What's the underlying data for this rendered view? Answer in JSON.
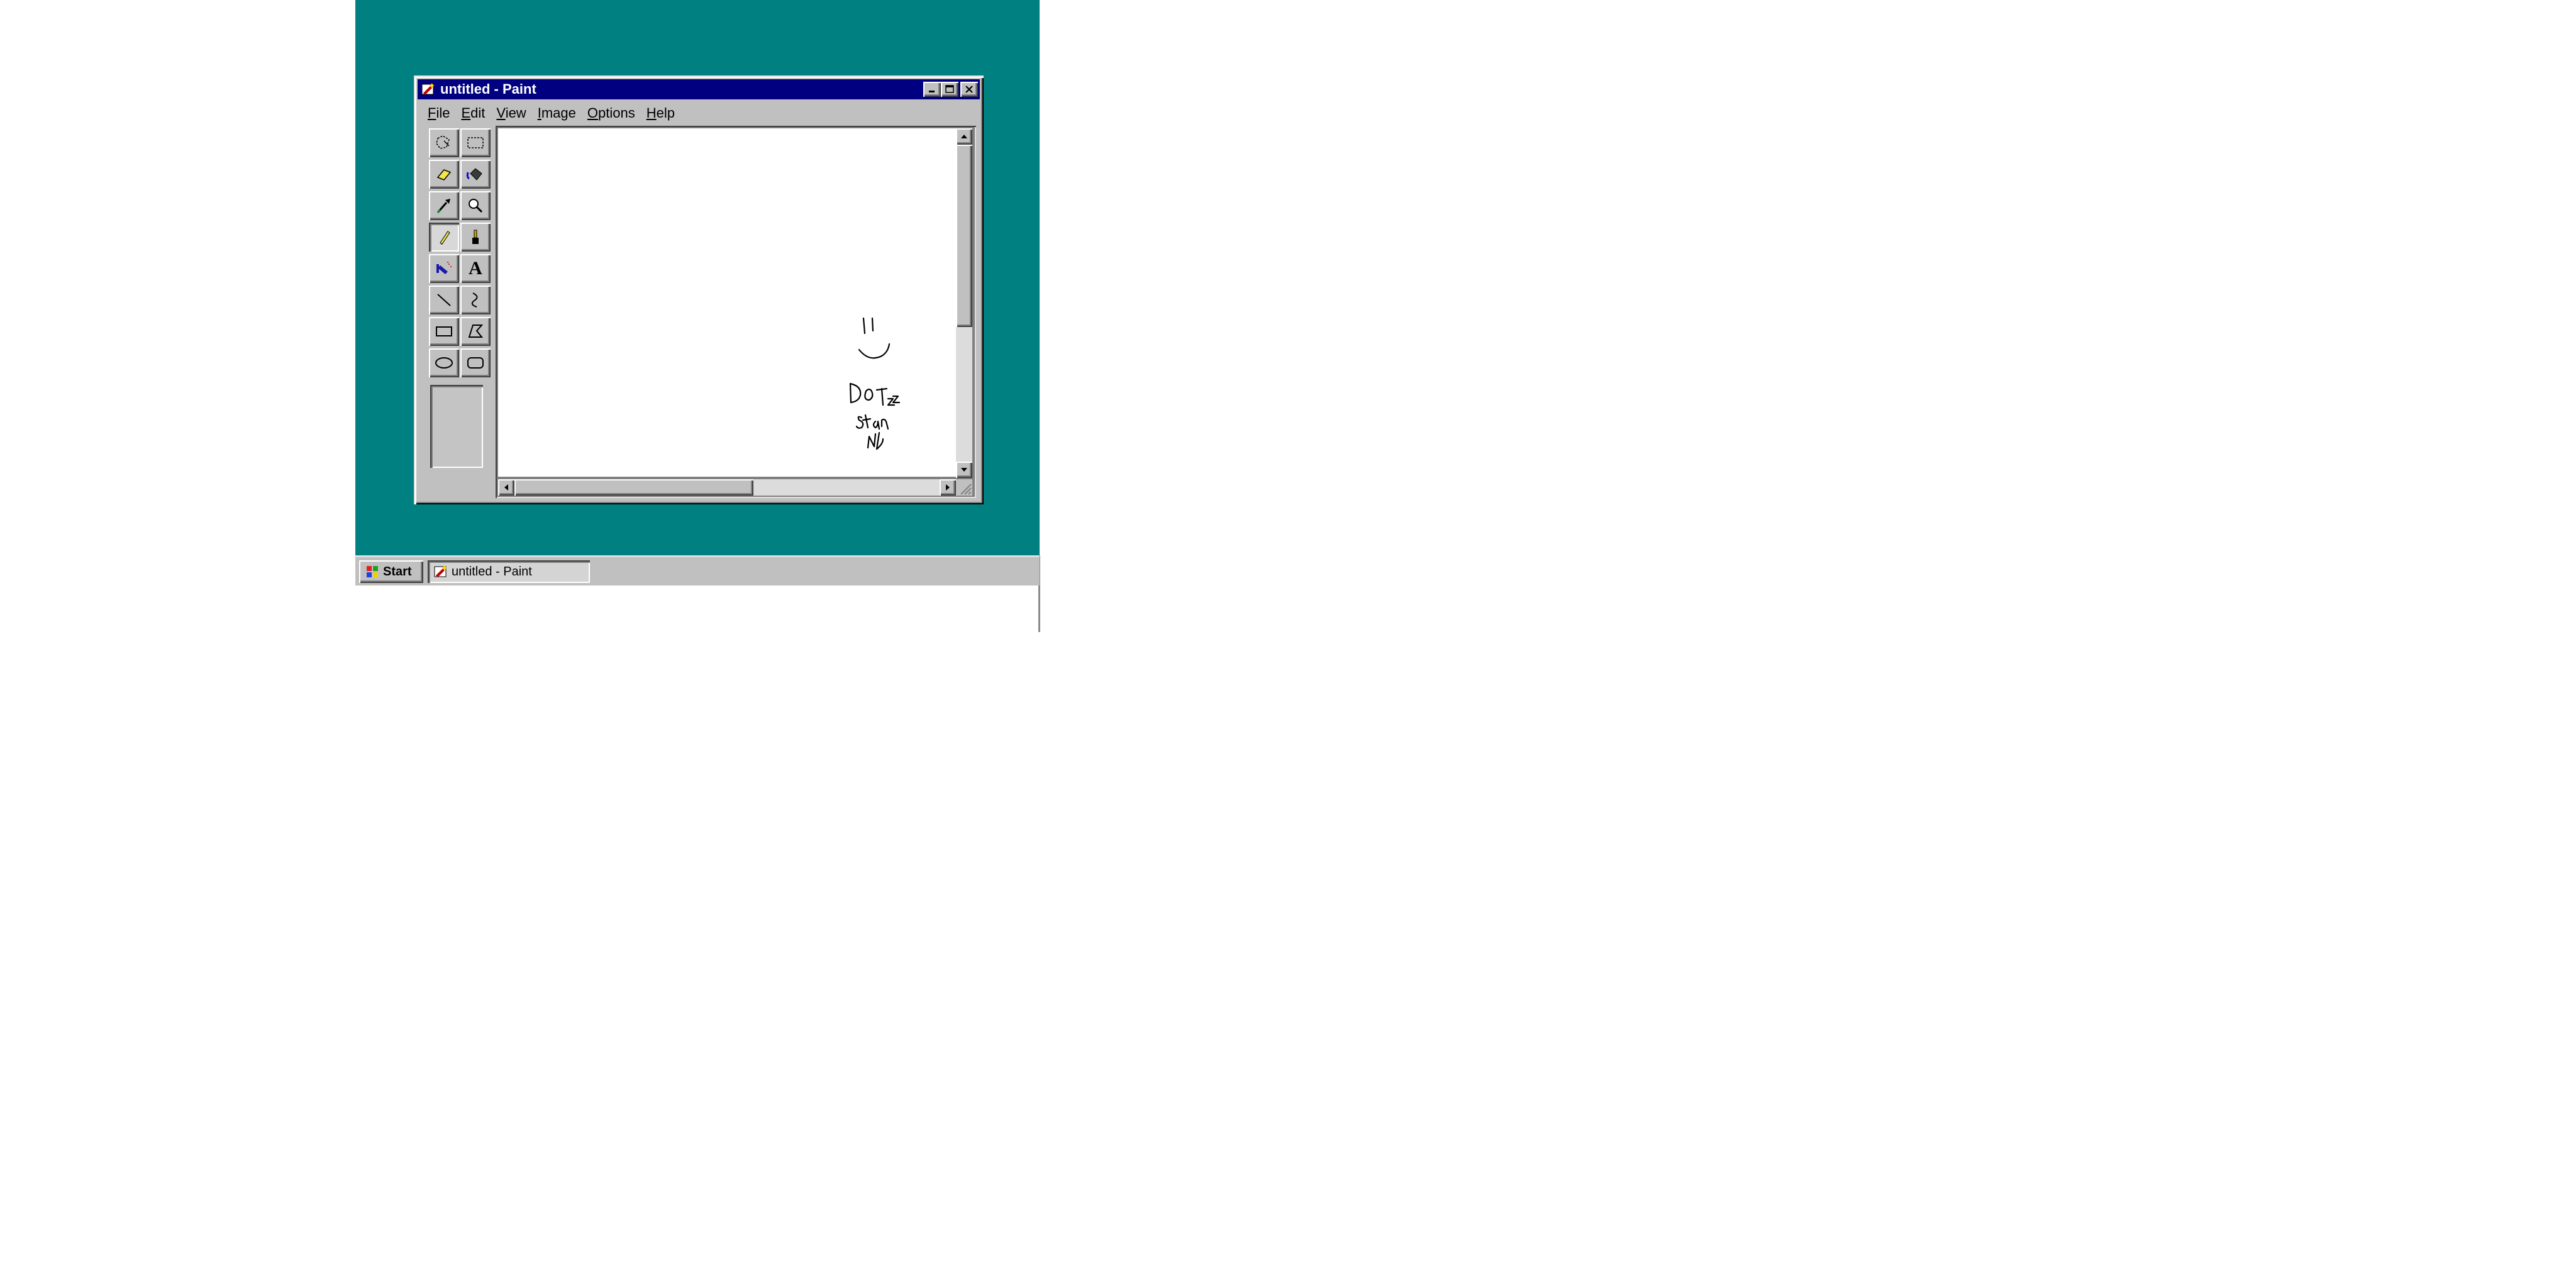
{
  "desktop": {
    "background_color": "#008080"
  },
  "window": {
    "title": "untitled - Paint",
    "titlebar_color": "#000080",
    "controls": [
      "minimize-icon",
      "maximize-icon",
      "close-icon"
    ]
  },
  "menubar": {
    "items": [
      {
        "underline": "F",
        "rest": "ile"
      },
      {
        "underline": "E",
        "rest": "dit"
      },
      {
        "underline": "V",
        "rest": "iew"
      },
      {
        "underline": "I",
        "rest": "mage"
      },
      {
        "underline": "O",
        "rest": "ptions"
      },
      {
        "underline": "H",
        "rest": "elp"
      }
    ]
  },
  "toolbox": {
    "tools": [
      "free-form-select-icon",
      "select-icon",
      "eraser-icon",
      "fill-with-color-icon",
      "pick-color-icon",
      "magnifier-icon",
      "pencil-icon",
      "brush-icon",
      "airbrush-icon",
      "text-icon",
      "line-icon",
      "curve-icon",
      "rectangle-icon",
      "polygon-icon",
      "ellipse-icon",
      "rounded-rectangle-icon"
    ],
    "selected_tool": "pencil-icon",
    "text_tool_glyph": "A"
  },
  "canvas": {
    "background": "#ffffff",
    "drawing": {
      "lines": [
        "Do",
        "Stan",
        "Nb",
        "Toz"
      ]
    }
  },
  "taskbar": {
    "start_label": "Start",
    "task_label": "untitled - Paint"
  }
}
